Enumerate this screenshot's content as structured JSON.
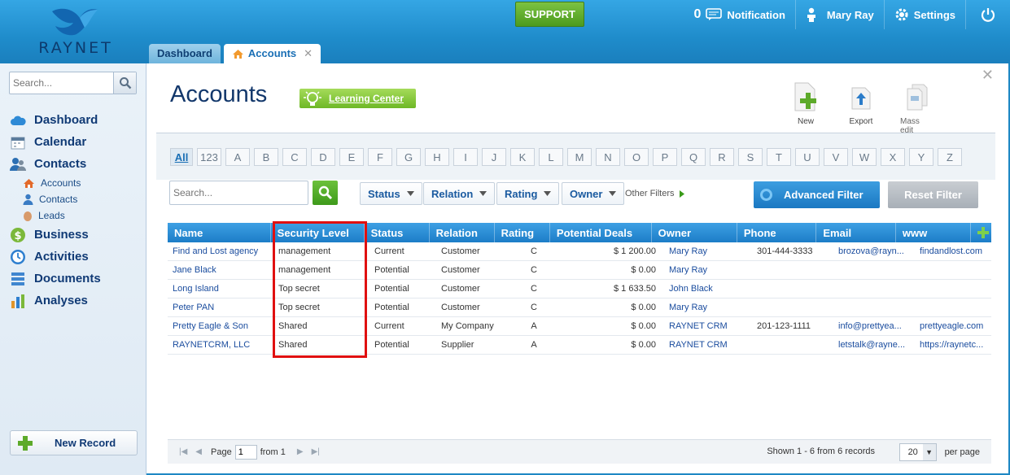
{
  "brand": {
    "name": "RAYNET"
  },
  "header": {
    "support_label": "SUPPORT",
    "notification_count": "0",
    "notification_label": "Notification",
    "user_name": "Mary Ray",
    "settings_label": "Settings"
  },
  "tabs": [
    {
      "label": "Dashboard",
      "active": false
    },
    {
      "label": "Accounts",
      "active": true
    }
  ],
  "sidebar": {
    "search_placeholder": "Search...",
    "items": [
      {
        "label": "Dashboard",
        "icon": "cloud-icon"
      },
      {
        "label": "Calendar",
        "icon": "calendar-icon"
      },
      {
        "label": "Contacts",
        "icon": "people-icon"
      },
      {
        "label": "Business",
        "icon": "dollar-icon"
      },
      {
        "label": "Activities",
        "icon": "clock-icon"
      },
      {
        "label": "Documents",
        "icon": "documents-icon"
      },
      {
        "label": "Analyses",
        "icon": "bar-chart-icon"
      }
    ],
    "contacts_sub": [
      {
        "label": "Accounts",
        "icon": "home-icon"
      },
      {
        "label": "Contacts",
        "icon": "person-icon"
      },
      {
        "label": "Leads",
        "icon": "egg-icon"
      }
    ],
    "new_record_label": "New Record"
  },
  "main": {
    "title": "Accounts",
    "learning_center_label": "Learning Center",
    "actions": [
      {
        "label": "New",
        "icon": "new-document-icon"
      },
      {
        "label": "Export",
        "icon": "export-icon"
      },
      {
        "label": "Mass edit",
        "icon": "mass-edit-icon"
      }
    ],
    "letters": [
      "All",
      "123",
      "A",
      "B",
      "C",
      "D",
      "E",
      "F",
      "G",
      "H",
      "I",
      "J",
      "K",
      "L",
      "M",
      "N",
      "O",
      "P",
      "Q",
      "R",
      "S",
      "T",
      "U",
      "V",
      "W",
      "X",
      "Y",
      "Z"
    ],
    "search_placeholder": "Search...",
    "filters": [
      "Status",
      "Relation",
      "Rating",
      "Owner"
    ],
    "other_filters_label": "Other Filters",
    "advanced_filter_label": "Advanced Filter",
    "reset_filter_label": "Reset Filter"
  },
  "table": {
    "columns": [
      "Name",
      "Security Level",
      "Status",
      "Relation",
      "Rating",
      "Potential Deals",
      "Owner",
      "Phone",
      "Email",
      "www"
    ],
    "rows": [
      [
        "Find and Lost agency",
        "management",
        "Current",
        "Customer",
        "C",
        "$ 1 200.00",
        "Mary Ray",
        "301-444-3333",
        "brozova@rayn...",
        "findandlost.com"
      ],
      [
        "Jane Black",
        "management",
        "Potential",
        "Customer",
        "C",
        "$ 0.00",
        "Mary Ray",
        "",
        "",
        ""
      ],
      [
        "Long Island",
        "Top secret",
        "Potential",
        "Customer",
        "C",
        "$ 1 633.50",
        "John Black",
        "",
        "",
        ""
      ],
      [
        "Peter PAN",
        "Top secret",
        "Potential",
        "Customer",
        "C",
        "$ 0.00",
        "Mary Ray",
        "",
        "",
        ""
      ],
      [
        "Pretty Eagle & Son",
        "Shared",
        "Current",
        "My Company",
        "A",
        "$ 0.00",
        "RAYNET CRM",
        "201-123-1111",
        "info@prettyea...",
        "prettyeagle.com"
      ],
      [
        "RAYNETCRM, LLC",
        "Shared",
        "Potential",
        "Supplier",
        "A",
        "$ 0.00",
        "RAYNET CRM",
        "",
        "letstalk@rayne...",
        "https://raynetc..."
      ]
    ]
  },
  "pager": {
    "page_label": "Page",
    "page_value": "1",
    "from_label": "from 1",
    "shown_label": "Shown 1 - 6 from 6 records",
    "per_page_value": "20",
    "per_page_label": "per page"
  }
}
